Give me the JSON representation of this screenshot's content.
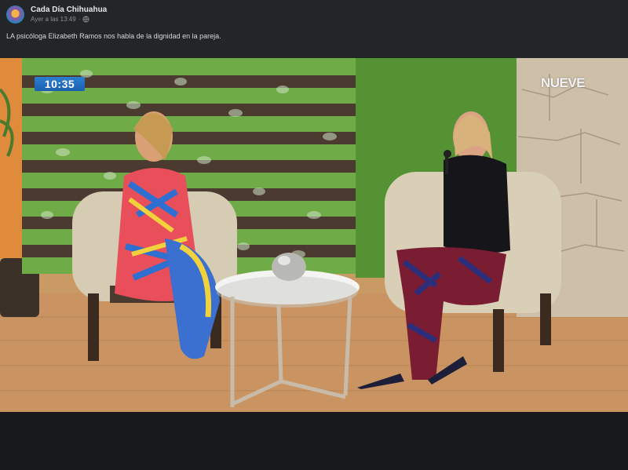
{
  "post": {
    "page_name": "Cada Día Chihuahua",
    "timestamp": "Ayer a las 13:49",
    "separator": "·",
    "privacy_icon": "globe-icon",
    "caption": "LA psicóloga Elizabeth Ramos nos habla de la dignidad en la pareja."
  },
  "video": {
    "clock": "10:35",
    "channel_logo": "NUEVE"
  },
  "colors": {
    "header_bg": "#242526",
    "page_bg": "#18191a",
    "clock_badge": "#1f6fc2"
  }
}
